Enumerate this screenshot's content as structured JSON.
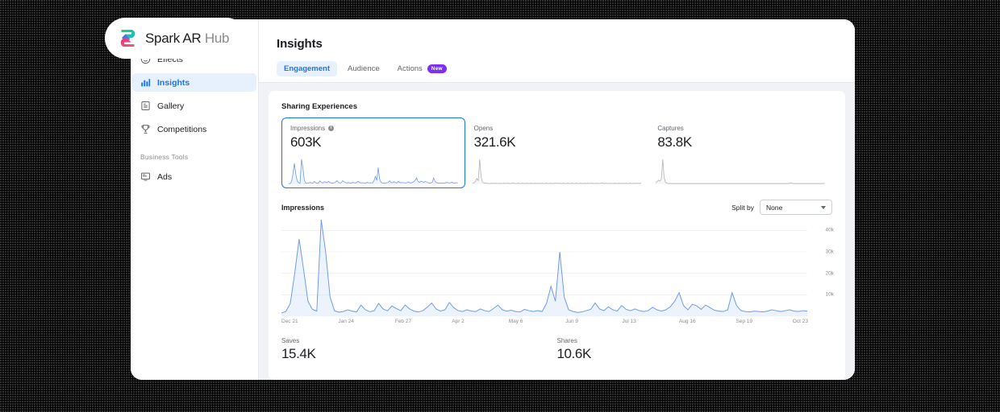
{
  "brand": {
    "name_bold": "Spark AR",
    "name_dim": "Hub",
    "logo_icon": "spark-ar-logo"
  },
  "sidebar": {
    "items": [
      {
        "label": "Effects",
        "icon": "smiley-icon",
        "active": false
      },
      {
        "label": "Insights",
        "icon": "bar-chart-icon",
        "active": true
      },
      {
        "label": "Gallery",
        "icon": "gallery-icon",
        "active": false
      },
      {
        "label": "Competitions",
        "icon": "trophy-icon",
        "active": false
      }
    ],
    "section_label": "Business Tools",
    "business_items": [
      {
        "label": "Ads",
        "icon": "monitor-icon",
        "active": false
      }
    ]
  },
  "header": {
    "title": "Insights"
  },
  "tabs": [
    {
      "label": "Engagement",
      "active": true,
      "badge": null
    },
    {
      "label": "Audience",
      "active": false,
      "badge": null
    },
    {
      "label": "Actions",
      "active": false,
      "badge": "New"
    }
  ],
  "sharing": {
    "section_title": "Sharing Experiences",
    "cards": [
      {
        "label": "Impressions",
        "value": "603K",
        "selected": true,
        "has_info": true
      },
      {
        "label": "Opens",
        "value": "321.6K",
        "selected": false,
        "has_info": false
      },
      {
        "label": "Captures",
        "value": "83.8K",
        "selected": false,
        "has_info": false
      }
    ]
  },
  "split_by": {
    "label": "Split by",
    "value": "None",
    "icon": "chevron-down-icon"
  },
  "bottom_stats": [
    {
      "label": "Saves",
      "value": "15.4K"
    },
    {
      "label": "Shares",
      "value": "10.6K"
    }
  ],
  "colors": {
    "accent": "#1877f2",
    "accent_bg": "#e7f0fd",
    "badge_purple": "#7b2ff7",
    "line": "#6f9ceb",
    "muted": "#8a8d91",
    "page_bg": "#f0f2f5"
  },
  "chart_data": {
    "type": "line",
    "title": "Impressions",
    "xlabel": "",
    "ylabel": "",
    "ylim": [
      0,
      45000
    ],
    "grid": true,
    "legend": "none",
    "ytick_labels": [
      "40k",
      "30k",
      "20k",
      "10k"
    ],
    "ytick_values": [
      40000,
      30000,
      20000,
      10000
    ],
    "xtick_labels": [
      "Dec 21",
      "Jan 24",
      "Feb 27",
      "Apr 2",
      "May 6",
      "Jun 9",
      "Jul 13",
      "Aug 16",
      "Sep 19",
      "Oct 23"
    ],
    "series": [
      {
        "name": "Impressions",
        "color": "#6f9ceb",
        "values": [
          1500,
          2200,
          6000,
          20000,
          36000,
          22000,
          7000,
          3200,
          2400,
          45000,
          30000,
          9000,
          2600,
          1900,
          2200,
          3000,
          2400,
          2000,
          5200,
          3000,
          2100,
          2600,
          6000,
          3400,
          2500,
          4800,
          3600,
          2600,
          5200,
          3400,
          2400,
          2000,
          2600,
          4200,
          6200,
          3400,
          2400,
          3000,
          6400,
          4000,
          2600,
          2200,
          3000,
          2400,
          2200,
          3400,
          2600,
          2200,
          3600,
          5200,
          3000,
          2400,
          2800,
          2200,
          2000,
          3200,
          2600,
          2200,
          2600,
          2200,
          6000,
          14000,
          7000,
          30000,
          9000,
          3000,
          2200,
          1800,
          2000,
          2600,
          3200,
          6200,
          3400,
          2600,
          4400,
          3000,
          2400,
          5000,
          3200,
          2600,
          3400,
          2600,
          2200,
          2600,
          4200,
          3000,
          2400,
          3000,
          4400,
          7000,
          11000,
          5000,
          3000,
          5600,
          4800,
          3200,
          5200,
          4000,
          2800,
          2400,
          2200,
          3000,
          11000,
          5000,
          2600,
          2200,
          2000,
          2400,
          2200,
          2000,
          2400,
          3000,
          2600,
          2200,
          2600,
          3000,
          2400,
          2200,
          2600,
          2400
        ]
      }
    ],
    "sparklines": [
      {
        "name": "Impressions",
        "color": "#6f9ceb",
        "values": [
          2,
          3,
          10,
          40,
          80,
          38,
          12,
          6,
          4,
          95,
          62,
          16,
          5,
          4,
          5,
          7,
          5,
          4,
          11,
          6,
          4,
          5,
          13,
          7,
          5,
          10,
          8,
          6,
          11,
          7,
          5,
          4,
          6,
          9,
          14,
          7,
          5,
          6,
          14,
          9,
          6,
          5,
          7,
          5,
          5,
          7,
          6,
          5,
          8,
          11,
          7,
          5,
          6,
          5,
          4,
          7,
          6,
          5,
          6,
          5,
          13,
          30,
          15,
          64,
          19,
          7,
          5,
          4,
          4,
          6,
          7,
          13,
          7,
          6,
          10,
          7,
          5,
          11,
          7,
          6,
          7,
          6,
          5,
          6,
          9,
          7,
          5,
          7,
          10,
          15,
          24,
          11,
          7,
          12,
          10,
          7,
          11,
          9,
          6,
          5,
          5,
          7,
          24,
          11,
          6,
          5,
          4,
          5,
          5,
          4,
          5,
          7,
          6,
          5,
          6,
          7,
          5,
          5,
          6,
          5
        ]
      },
      {
        "name": "Opens",
        "color": "#b0b3b8",
        "values": [
          4,
          6,
          10,
          22,
          14,
          96,
          30,
          8,
          5,
          4,
          4,
          3,
          3,
          4,
          3,
          3,
          4,
          3,
          3,
          4,
          3,
          3,
          4,
          3,
          3,
          4,
          3,
          3,
          4,
          4,
          3,
          3,
          4,
          3,
          3,
          4,
          3,
          3,
          4,
          3,
          3,
          4,
          3,
          3,
          4,
          3,
          4,
          3,
          3,
          4,
          3,
          3,
          4,
          3,
          3,
          4,
          3,
          3,
          4,
          4,
          3,
          4,
          3,
          3,
          4,
          3,
          3,
          4,
          3,
          3,
          4,
          3,
          3,
          4,
          3,
          3,
          4,
          3,
          3,
          4,
          3,
          4,
          3,
          3,
          4,
          3,
          3,
          4,
          3,
          3,
          4,
          5,
          4,
          3,
          4,
          3,
          3,
          4,
          3,
          3,
          4,
          3,
          3,
          4,
          3,
          4,
          3,
          3,
          4,
          3,
          3,
          4,
          3,
          3,
          4,
          3,
          4,
          3,
          4,
          5
        ]
      },
      {
        "name": "Captures",
        "color": "#b0b3b8",
        "values": [
          6,
          10,
          16,
          12,
          20,
          98,
          26,
          7,
          4,
          3,
          3,
          3,
          3,
          3,
          3,
          3,
          3,
          3,
          3,
          3,
          3,
          3,
          3,
          3,
          3,
          3,
          3,
          3,
          3,
          3,
          3,
          3,
          3,
          3,
          3,
          3,
          3,
          3,
          3,
          3,
          3,
          3,
          3,
          3,
          3,
          3,
          3,
          3,
          3,
          3,
          3,
          3,
          3,
          3,
          3,
          3,
          3,
          3,
          3,
          3,
          3,
          3,
          3,
          3,
          3,
          3,
          3,
          3,
          3,
          3,
          3,
          3,
          3,
          3,
          3,
          3,
          3,
          3,
          3,
          3,
          3,
          3,
          3,
          3,
          3,
          3,
          3,
          3,
          3,
          3,
          3,
          3,
          3,
          3,
          3,
          6,
          4,
          3,
          3,
          3,
          3,
          3,
          3,
          3,
          3,
          3,
          3,
          3,
          3,
          3,
          3,
          3,
          3,
          3,
          3,
          3,
          3,
          3,
          3,
          4
        ]
      }
    ]
  }
}
